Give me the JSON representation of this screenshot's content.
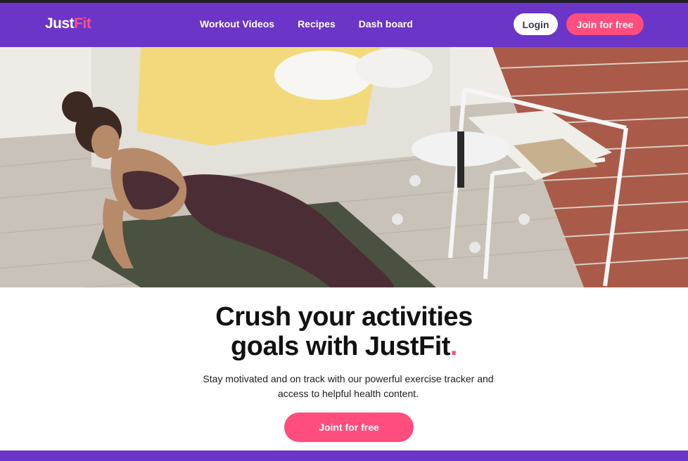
{
  "brand": {
    "name_main": "Just",
    "name_accent": "Fit"
  },
  "nav": {
    "links": [
      {
        "label": "Workout Videos"
      },
      {
        "label": "Recipes"
      },
      {
        "label": "Dash board"
      }
    ],
    "login_label": "Login",
    "join_label": "Join for free"
  },
  "hero": {
    "headline_line1": "Crush your activities",
    "headline_line2": "goals with JustFit",
    "headline_dot": ".",
    "subtext": "Stay motivated and on track with our powerful exercise tracker and access to helpful health content.",
    "cta_label": "Joint for free"
  },
  "colors": {
    "brand_purple": "#6b35c7",
    "accent_pink": "#ff4d7d",
    "text_dark": "#111111"
  }
}
